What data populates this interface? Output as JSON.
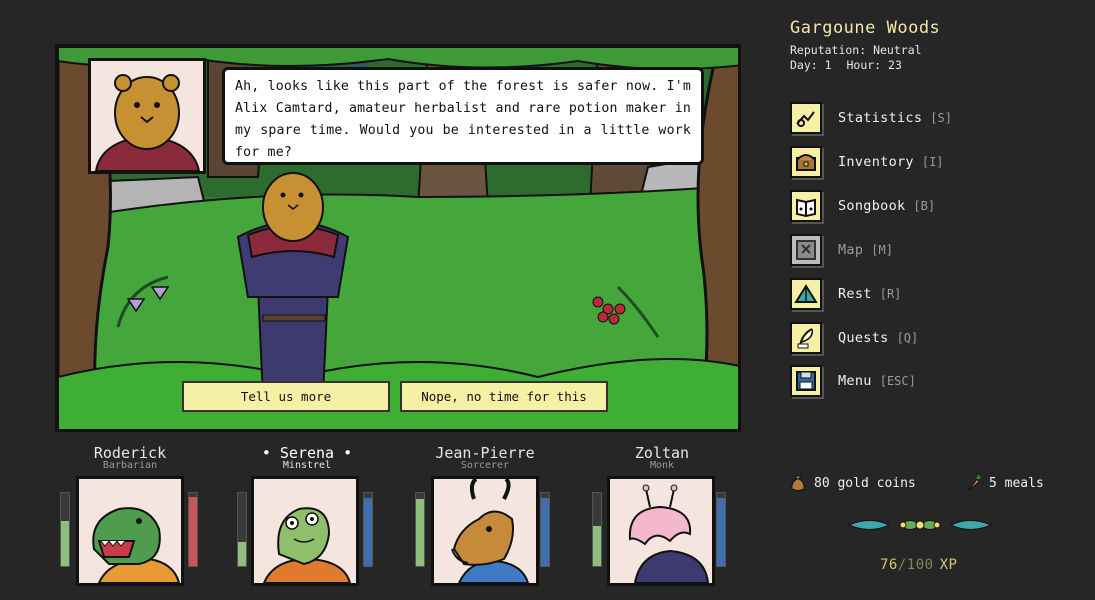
{
  "location": {
    "title": "Gargoune Woods",
    "reputation": "Reputation: Neutral",
    "day": "Day: 1",
    "hour": "Hour: 23"
  },
  "dialogue": {
    "text": "Ah, looks like this part of the forest is safer now. I'm Alix Camtard, amateur herbalist and rare potion maker in my spare time. Would you be interested in a little work for me?",
    "choices": [
      "Tell us more",
      "Nope, no time for this"
    ]
  },
  "menu": [
    {
      "label": "Statistics",
      "key": "[S]",
      "icon": "statistics-icon",
      "enabled": true
    },
    {
      "label": "Inventory",
      "key": "[I]",
      "icon": "chest-icon",
      "enabled": true
    },
    {
      "label": "Songbook",
      "key": "[B]",
      "icon": "songbook-icon",
      "enabled": true
    },
    {
      "label": "Map",
      "key": "[M]",
      "icon": "map-icon",
      "enabled": false
    },
    {
      "label": "Rest",
      "key": "[R]",
      "icon": "tent-icon",
      "enabled": true
    },
    {
      "label": "Quests",
      "key": "[Q]",
      "icon": "quill-icon",
      "enabled": true
    },
    {
      "label": "Menu",
      "key": "[ESC]",
      "icon": "floppy-disk-icon",
      "enabled": true
    }
  ],
  "party": [
    {
      "name": "Roderick",
      "class": "Barbarian",
      "active": false,
      "health": 0.62,
      "resource": 0.95,
      "resource_color": "#c9545a",
      "avatar": "dinosaur"
    },
    {
      "name": "Serena",
      "class": "Minstrel",
      "active": true,
      "health": 0.33,
      "resource": 0.93,
      "resource_color": "#3f6fae",
      "avatar": "lizard"
    },
    {
      "name": "Jean-Pierre",
      "class": "Sorcerer",
      "active": false,
      "health": 0.92,
      "resource": 0.93,
      "resource_color": "#3f6fae",
      "avatar": "antelope"
    },
    {
      "name": "Zoltan",
      "class": "Monk",
      "active": false,
      "health": 0.55,
      "resource": 0.93,
      "resource_color": "#3f6fae",
      "avatar": "slug"
    }
  ],
  "resources": {
    "gold": "80 gold coins",
    "meals": "5 meals"
  },
  "xp": {
    "current": "76",
    "separator": "/",
    "max": "100",
    "unit": "XP"
  },
  "colors": {
    "background": "#262626",
    "button_yellow": "#f6f0a6",
    "title_yellow": "#f1e8a6",
    "health_green": "#8fbf7f"
  }
}
